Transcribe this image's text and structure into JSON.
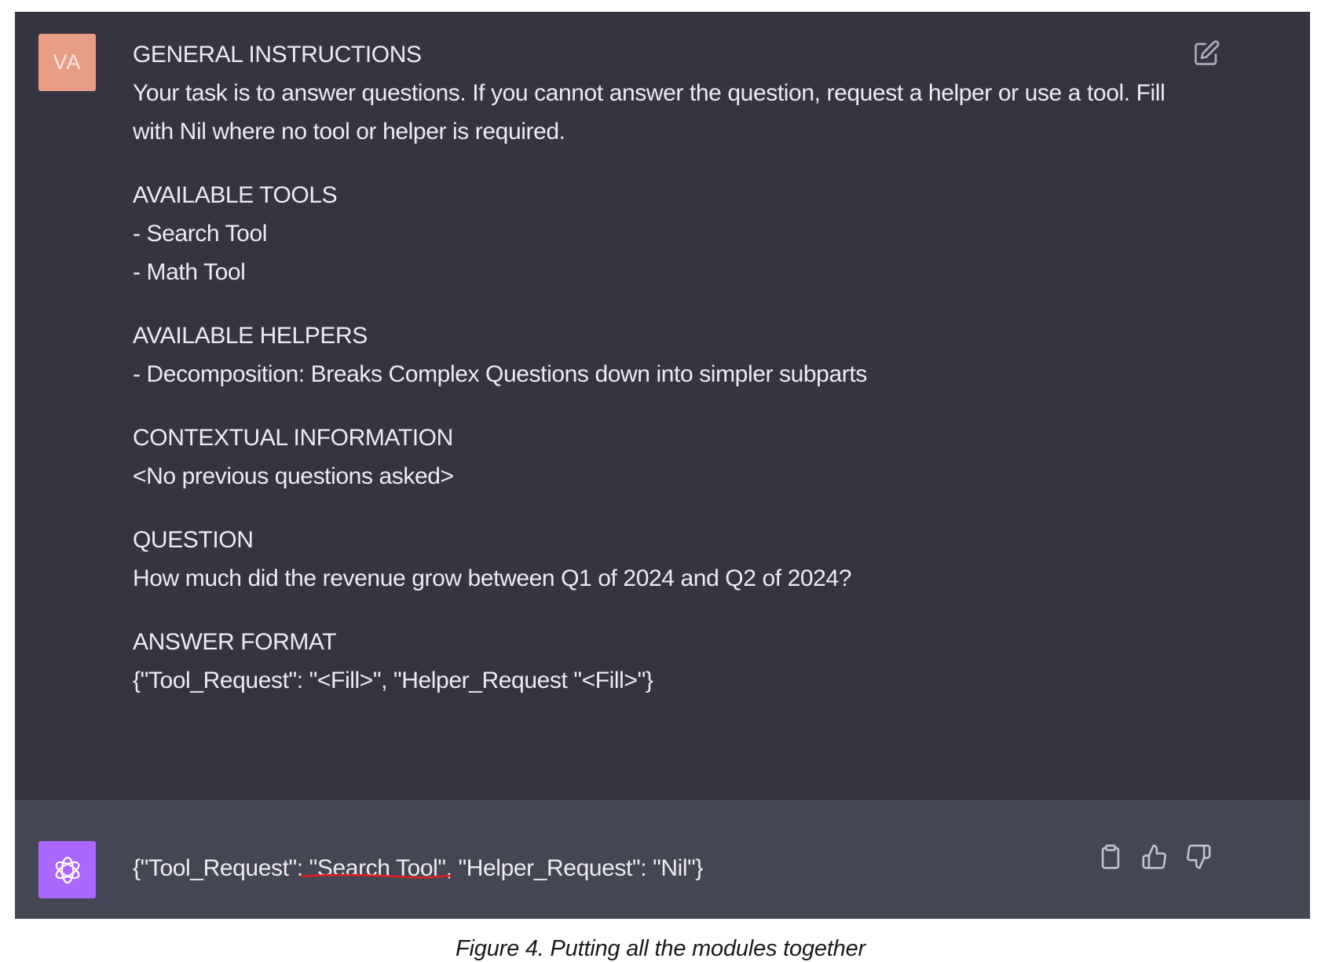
{
  "user_message": {
    "avatar_initials": "VA",
    "avatar_color": "#ea9d86",
    "sections": [
      {
        "heading": "GENERAL INSTRUCTIONS",
        "lines": [
          "Your task is to answer questions. If you cannot answer the question, request a helper or use a tool. Fill with Nil where no tool or helper is required."
        ]
      },
      {
        "heading": "AVAILABLE TOOLS",
        "lines": [
          "- Search Tool",
          "- Math Tool"
        ]
      },
      {
        "heading": "AVAILABLE HELPERS",
        "lines": [
          "- Decomposition: Breaks Complex Questions down into simpler subparts"
        ]
      },
      {
        "heading": "CONTEXTUAL INFORMATION",
        "lines": [
          "<No previous questions asked>"
        ]
      },
      {
        "heading": "QUESTION",
        "lines": [
          "How much did the revenue grow between Q1 of 2024 and Q2 of 2024?"
        ]
      },
      {
        "heading": "ANSWER FORMAT",
        "lines": [
          "{\"Tool_Request\": \"<Fill>\", \"Helper_Request \"<Fill>\"}"
        ]
      }
    ],
    "edit_icon": "edit-icon"
  },
  "assistant_message": {
    "avatar_icon": "openai-logo-icon",
    "avatar_color": "#ab68ff",
    "response_prefix": "{\"Tool_Request\": ",
    "response_highlight": "\"Search Tool\"",
    "response_suffix": ", \"Helper_Request\": \"Nil\"}",
    "highlight_color": "#e0201a",
    "actions": [
      "copy-icon",
      "thumbs-up-icon",
      "thumbs-down-icon"
    ]
  },
  "caption": "Figure 4. Putting all the modules together"
}
